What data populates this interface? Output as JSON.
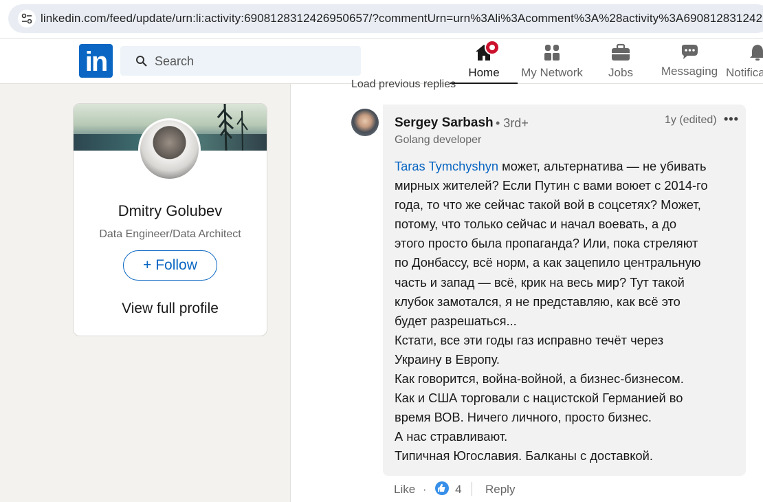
{
  "browser": {
    "url": "linkedin.com/feed/update/urn:li:activity:6908128312426950657/?commentUrn=urn%3Ali%3Acomment%3A%28activity%3A690812831242"
  },
  "nav": {
    "logo": "in",
    "search_placeholder": "Search",
    "items": [
      {
        "label": "Home",
        "icon": "home-icon",
        "active": true
      },
      {
        "label": "My Network",
        "icon": "network-icon"
      },
      {
        "label": "Jobs",
        "icon": "briefcase-icon"
      },
      {
        "label": "Messaging",
        "icon": "chat-icon"
      },
      {
        "label": "Notifica",
        "icon": "bell-icon"
      }
    ]
  },
  "profile_card": {
    "name": "Dmitry Golubev",
    "title": "Data Engineer/Data Architect",
    "follow_label": "Follow",
    "follow_icon": "+",
    "view_profile_label": "View full profile"
  },
  "comments": {
    "load_previous": "Load previous replies",
    "comment": {
      "author": "Sergey Sarbash",
      "degree": "• 3rd+",
      "headline": "Golang developer",
      "time": "1y (edited)",
      "more": "•••",
      "mention": "Taras Tymchyshyn",
      "lines": [
        " может, альтернатива — не убивать",
        "мирных жителей? Если Путин с вами воюет с 2014-го",
        "года, то что же сейчас такой вой в соцсетях? Может,",
        "потому, что только сейчас и начал воевать, а до",
        "этого просто была пропаганда? Или, пока стреляют",
        "по Донбассу, всё норм, а как зацепило центральную",
        "часть и запад — всё, крик на весь мир? Тут такой",
        "клубок замотался, я не представляю, как всё это",
        "будет разрешаться...",
        "Кстати, все эти годы газ исправно течёт через",
        "Украину в Европу.",
        "Как говорится, война-войной, а бизнес-бизнесом.",
        "Как и США торговали с нацистской Германией во",
        "время ВОВ. Ничего личного, просто бизнес.",
        "А нас стравливают.",
        "Типичная Югославия. Балканы с доставкой."
      ],
      "like_label": "Like",
      "dot": "·",
      "like_count": "4",
      "reply_label": "Reply"
    }
  },
  "colors": {
    "brand": "#0a66c2",
    "badge": "#cb112d",
    "like": "#378fe9"
  }
}
